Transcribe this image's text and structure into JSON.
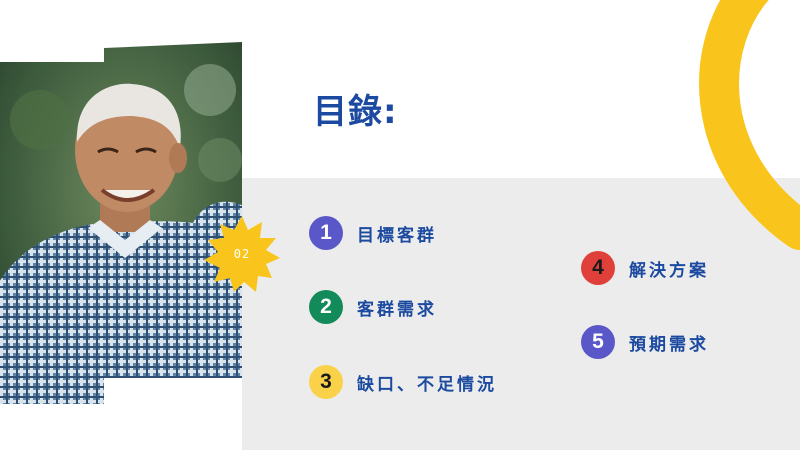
{
  "title": "目錄:",
  "page_number": "02",
  "colors": {
    "accent_blue": "#1b4aa0",
    "accent_yellow": "#f9c51d",
    "panel_gray": "#ececec"
  },
  "photo": {
    "description_icon": "elderly-man-photo"
  },
  "toc": [
    {
      "number": "1",
      "label": "目標客群",
      "color": "#5a58c8",
      "text_color": "#ffffff"
    },
    {
      "number": "2",
      "label": "客群需求",
      "color": "#138a5a",
      "text_color": "#ffffff"
    },
    {
      "number": "3",
      "label": "缺口、不足情況",
      "color": "#f9d24a",
      "text_color": "#1a1a1a"
    },
    {
      "number": "4",
      "label": "解決方案",
      "color": "#e0403a",
      "text_color": "#1a1a1a"
    },
    {
      "number": "5",
      "label": "預期需求",
      "color": "#5a58c8",
      "text_color": "#ffffff"
    }
  ]
}
